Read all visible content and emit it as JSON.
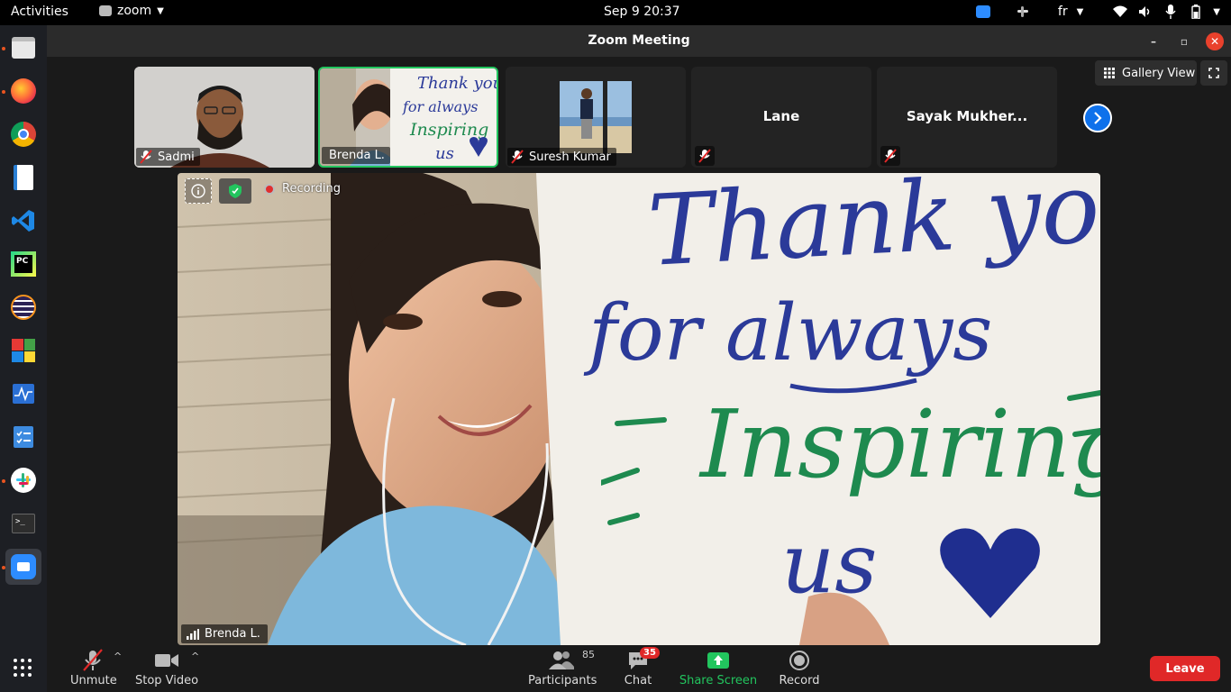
{
  "topbar": {
    "activities": "Activities",
    "app_name": "zoom",
    "clock": "Sep 9  20:37",
    "keyboard_layout": "fr"
  },
  "window": {
    "title": "Zoom Meeting",
    "view_button": "Gallery View"
  },
  "thumbnails": [
    {
      "name": "Sadmi",
      "muted": true,
      "video": true
    },
    {
      "name": "Brenda L.",
      "muted": false,
      "video": true,
      "speaking": true
    },
    {
      "name": "Suresh Kumar",
      "muted": true,
      "video": true
    },
    {
      "name": "Lane",
      "muted": true,
      "video": false
    },
    {
      "name": "Sayak Mukher...",
      "muted": true,
      "video": false
    }
  ],
  "main_video": {
    "recording_label": "Recording",
    "speaker_name": "Brenda L.",
    "sign_lines": [
      "Thank you",
      "for always",
      "Inspiring",
      "us"
    ]
  },
  "toolbar": {
    "unmute": "Unmute",
    "stop_video": "Stop Video",
    "participants": "Participants",
    "participants_count": "85",
    "chat": "Chat",
    "chat_badge": "35",
    "share_screen": "Share Screen",
    "record": "Record",
    "leave": "Leave"
  },
  "colors": {
    "accent_blue": "#0e71eb",
    "share_green": "#22c55e",
    "leave_red": "#e02828",
    "ubuntu_orange": "#e95420"
  }
}
